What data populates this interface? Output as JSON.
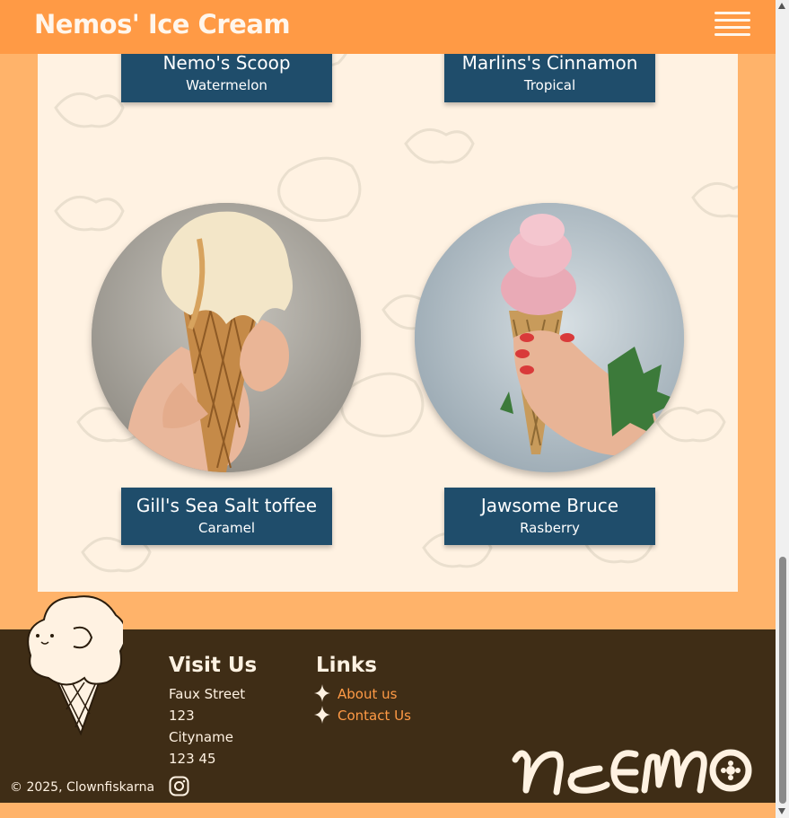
{
  "header": {
    "title": "Nemos' Ice Cream",
    "menu_icon": "hamburger-menu-icon"
  },
  "products": [
    {
      "name": "Nemo's Scoop",
      "flavor": "Watermelon"
    },
    {
      "name": "Marlins's Cinnamon",
      "flavor": "Tropical"
    },
    {
      "name": "Gill's Sea Salt toffee",
      "flavor": "Caramel"
    },
    {
      "name": "Jawsome Bruce",
      "flavor": "Rasberry"
    }
  ],
  "footer": {
    "visit_heading": "Visit Us",
    "address": [
      "Faux Street",
      "123",
      "Cityname",
      "123 45"
    ],
    "links_heading": "Links",
    "links": [
      "About us",
      "Contact Us"
    ],
    "copyright": "© 2025, Clownfiskarna",
    "social_icon": "instagram-icon",
    "brand": "NEMO"
  },
  "colors": {
    "header": "#ff9a45",
    "accent_link": "#ff9a45",
    "card": "#1f4d6b",
    "footer": "#3f2d16",
    "content_bg": "#fff2e2"
  }
}
